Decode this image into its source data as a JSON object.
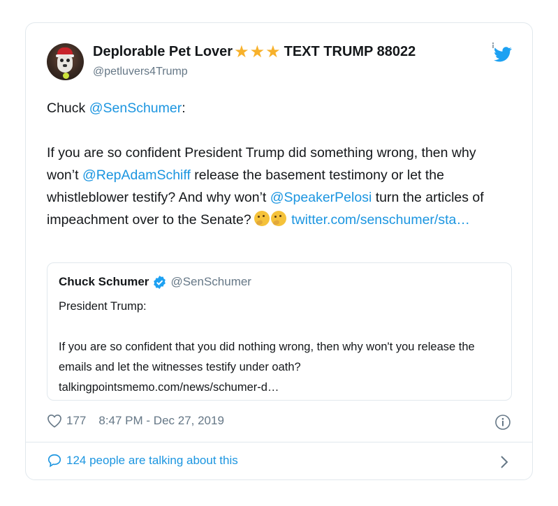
{
  "tweet": {
    "author": {
      "display_name": "Deplorable Pet Lover",
      "name_suffix": "TEXT TRUMP 88022",
      "handle": "@petluvers4Trump",
      "star_count": 3
    },
    "body": {
      "line1_prefix": "Chuck ",
      "mention_schumer": "@SenSchumer",
      "line1_suffix": ":",
      "p2_part1": "If you are so confident President Trump did something wrong, then why won’t ",
      "mention_schiff": "@RepAdamSchiff",
      "p2_part2": " release the basement testimony or let the whistleblower testify? And why won’t ",
      "mention_pelosi": "@SpeakerPelosi",
      "p2_part3": " turn the articles of impeachment over to the Senate?",
      "link": "twitter.com/senschumer/sta…"
    },
    "quoted": {
      "name": "Chuck Schumer",
      "handle": "@SenSchumer",
      "line1": "President Trump:",
      "line2": "If you are so confident that you did nothing wrong, then why won't you release the emails and let the witnesses testify under oath?talkingpointsmemo.com/news/schumer-d…"
    },
    "likes": "177",
    "timestamp": "8:47 PM - Dec 27, 2019",
    "conversation": "124 people are talking about this"
  },
  "colors": {
    "link": "#1b95e0",
    "muted": "#657786",
    "border": "#e1e8ed",
    "star": "#f7b12b"
  },
  "icons": [
    "star-icon",
    "twitter-bird-icon",
    "verified-badge-icon",
    "heart-icon",
    "info-icon",
    "speech-bubble-icon",
    "chevron-right-icon",
    "thinking-face-emoji"
  ]
}
